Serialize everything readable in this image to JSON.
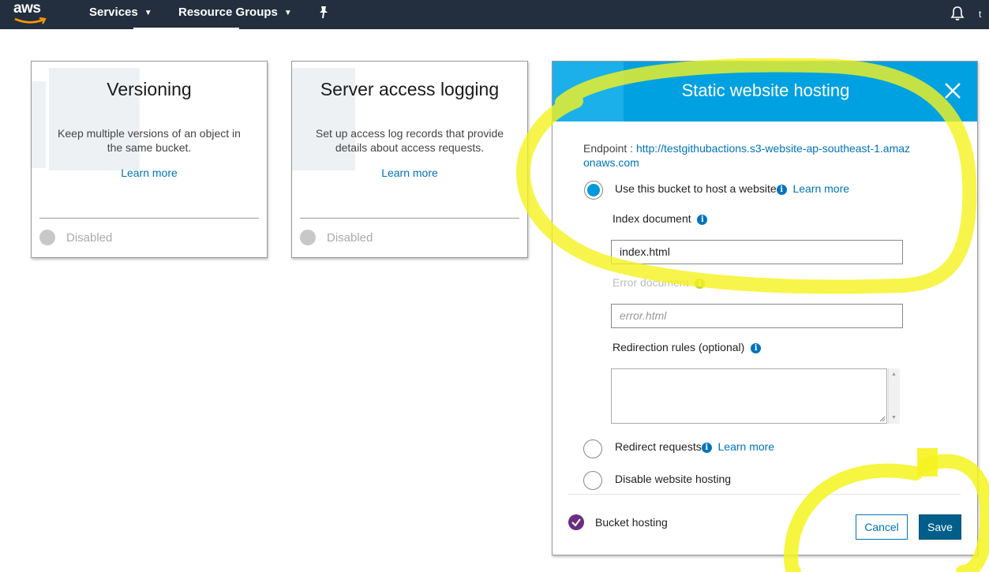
{
  "topbar": {
    "logo": "aws",
    "services_label": "Services",
    "resource_groups_label": "Resource Groups",
    "user_truncated": "t"
  },
  "cards": [
    {
      "title": "Versioning",
      "description": "Keep multiple versions of an object in the same bucket.",
      "learn_more": "Learn more",
      "status": "Disabled"
    },
    {
      "title": "Server access logging",
      "description": "Set up access log records that provide details about access requests.",
      "learn_more": "Learn more",
      "status": "Disabled"
    }
  ],
  "panel": {
    "title": "Static website hosting",
    "endpoint_label": "Endpoint : ",
    "endpoint_url": "http://testgithubactions.s3-website-ap-southeast-1.amazonaws.com",
    "option_host": "Use this bucket to host a website",
    "option_redirect": "Redirect requests",
    "option_disable": "Disable website hosting",
    "learn_more": "Learn more",
    "index_label": "Index document",
    "index_value": "index.html",
    "error_label": "Error document",
    "error_placeholder": "error.html",
    "redirection_label": "Redirection rules (optional)",
    "bucket_hosting_label": "Bucket hosting",
    "cancel_label": "Cancel",
    "save_label": "Save",
    "selected_option": "host"
  },
  "colors": {
    "topbar": "#232f3e",
    "header": "#00a1e0",
    "link": "#0073bb",
    "save_button": "#005f8a",
    "check": "#6b2e82",
    "highlight": "#f5f31e"
  }
}
